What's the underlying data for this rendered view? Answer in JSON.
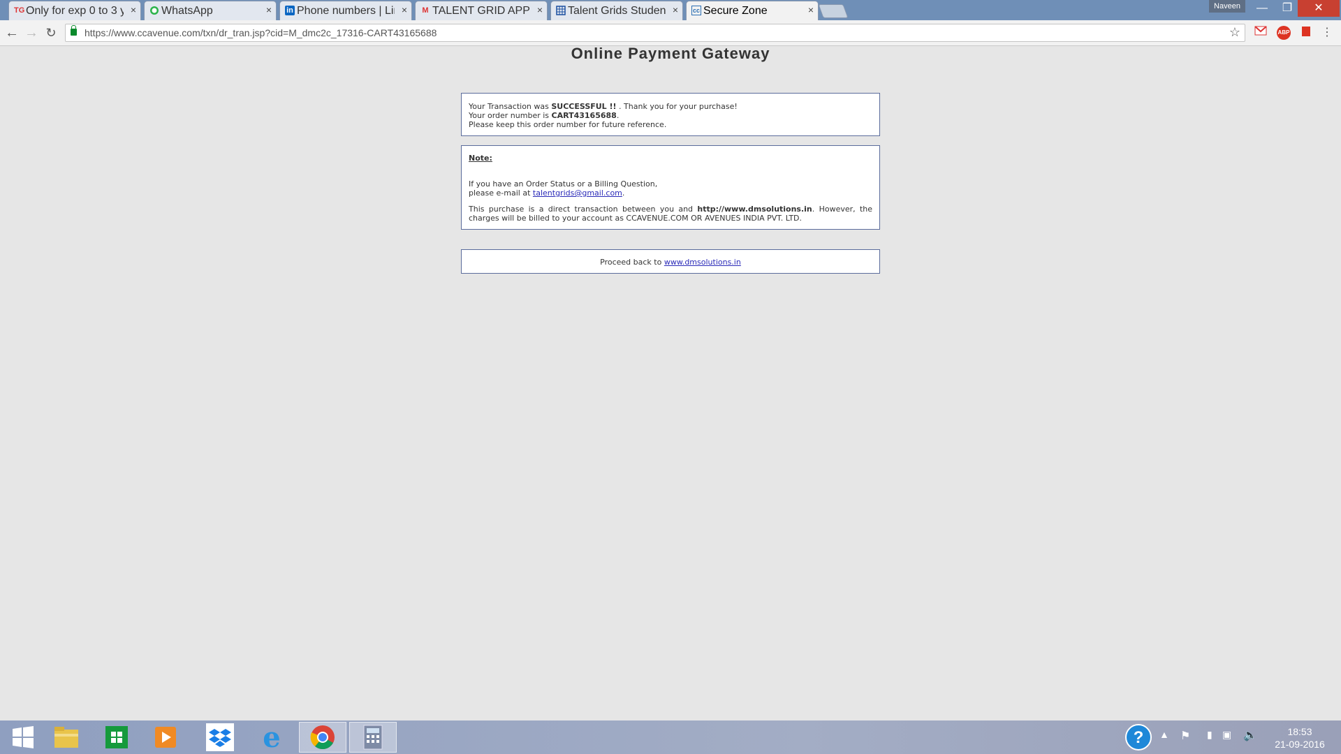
{
  "browser": {
    "tabs": [
      {
        "favicon": "TG",
        "label": "Only for exp 0 to 3 y",
        "close": "×"
      },
      {
        "favicon": "whatsapp-icon",
        "label": "WhatsApp",
        "close": "×"
      },
      {
        "favicon": "in",
        "label": "Phone numbers | Lin",
        "close": "×"
      },
      {
        "favicon": "M",
        "label": "TALENT GRID APPLY",
        "close": "×"
      },
      {
        "favicon": "sheets-icon",
        "label": "Talent Grids Studen",
        "close": "×"
      },
      {
        "favicon": "cc",
        "label": "Secure Zone",
        "close": "×",
        "active": true
      }
    ],
    "user": "Naveen",
    "url": "https://www.ccavenue.com/txn/dr_tran.jsp?cid=M_dmc2c_17316-CART43165688",
    "extensions": [
      "gmail-icon",
      "ABP",
      "red-square-icon"
    ]
  },
  "page": {
    "title": "Online Payment Gateway",
    "status": {
      "line1_prefix": "Your Transaction was ",
      "line1_bold": "SUCCESSFUL !!",
      "line1_suffix": " . Thank you for your purchase!",
      "line2_prefix": "Your order number is ",
      "order_number": "CART43165688",
      "line2_suffix": ".",
      "line3": "Please keep this order number for future reference."
    },
    "note": {
      "label": "Note:",
      "line1": "If you have an Order Status or a Billing Question,",
      "line2_prefix": "please e-mail at ",
      "email": "talentgrids@gmail.com",
      "line2_suffix": ".",
      "para_prefix": "This purchase is a direct transaction between you and ",
      "merchant": "http://www.dmsolutions.in",
      "para_suffix": ". However, the charges will be billed to your account as CCAVENUE.COM OR AVENUES INDIA PVT. LTD."
    },
    "proceed": {
      "prefix": "Proceed back to ",
      "link": "www.dmsolutions.in"
    }
  },
  "taskbar": {
    "apps": [
      "windows-start-icon",
      "file-explorer-icon",
      "store-icon",
      "media-player-icon",
      "dropbox-icon",
      "internet-explorer-icon",
      "chrome-icon",
      "calculator-icon"
    ],
    "time": "18:53",
    "date": "21-09-2016"
  }
}
